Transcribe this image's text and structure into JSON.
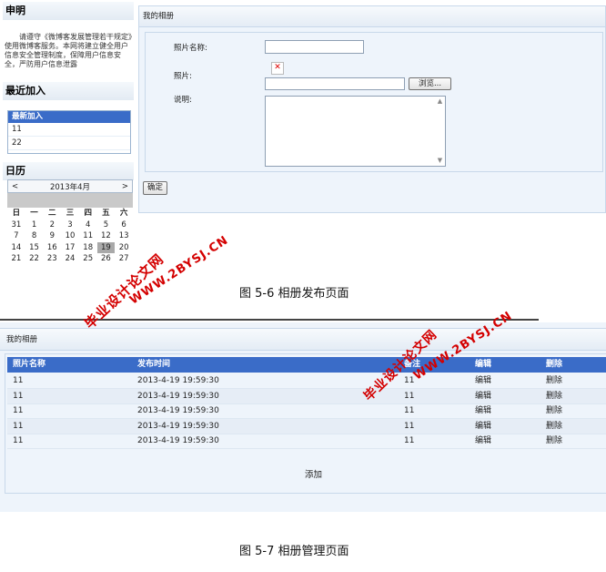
{
  "fig1": {
    "sidebar": {
      "notice_title": "申明",
      "notice_text": "请遵守《微博客发展管理若干规定》使用微博客服务。本网将建立健全用户信息安全管理制度，保障用户信息安全，严防用户信息泄露",
      "recent_title": "最近加入",
      "recent_box_head": "最新加入",
      "recent_items": [
        "11",
        "22"
      ],
      "calendar_title": "日历",
      "calendar": {
        "prev": "<",
        "next": ">",
        "month_label": "2013年4月",
        "weekdays": [
          "日",
          "一",
          "二",
          "三",
          "四",
          "五",
          "六"
        ],
        "days": [
          [
            "31",
            "1",
            "2",
            "3",
            "4",
            "5",
            "6"
          ],
          [
            "7",
            "8",
            "9",
            "10",
            "11",
            "12",
            "13"
          ],
          [
            "14",
            "15",
            "16",
            "17",
            "18",
            "19",
            "20"
          ],
          [
            "21",
            "22",
            "23",
            "24",
            "25",
            "26",
            "27"
          ]
        ],
        "today": "19"
      }
    },
    "panel": {
      "title": "我的相册",
      "photo_name_label": "照片名称:",
      "photo_label": "照片:",
      "browse_label": "浏览...",
      "desc_label": "说明:",
      "confirm_label": "确定"
    }
  },
  "caption1": "图 5-6 相册发布页面",
  "fig2": {
    "title": "我的相册",
    "columns": [
      "照片名称",
      "发布时间",
      "备注",
      "编辑",
      "删除"
    ],
    "rows": [
      [
        "11",
        "2013-4-19 19:59:30",
        "11",
        "编辑",
        "删除"
      ],
      [
        "11",
        "2013-4-19 19:59:30",
        "11",
        "编辑",
        "删除"
      ],
      [
        "11",
        "2013-4-19 19:59:30",
        "11",
        "编辑",
        "删除"
      ],
      [
        "11",
        "2013-4-19 19:59:30",
        "11",
        "编辑",
        "删除"
      ],
      [
        "11",
        "2013-4-19 19:59:30",
        "11",
        "编辑",
        "删除"
      ]
    ],
    "add_label": "添加"
  },
  "caption2": "图 5-7 相册管理页面",
  "watermarks": {
    "site": "WWW.2BYSJ.CN",
    "name": "毕业设计论文网"
  },
  "colors": {
    "accent_blue": "#3a6cc8",
    "panel_bg": "#eef4fb",
    "watermark_red": "#d40000"
  }
}
